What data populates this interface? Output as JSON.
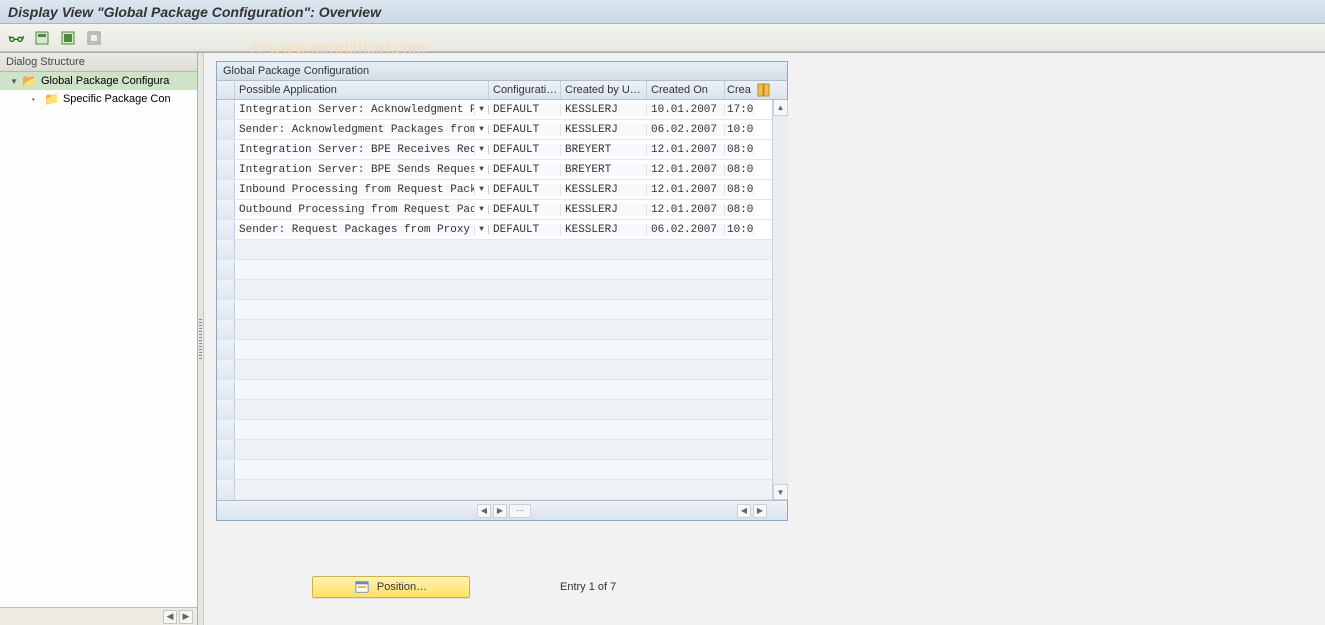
{
  "title": "Display View \"Global Package Configuration\": Overview",
  "watermark": "© www.tutorialkart.com",
  "toolbar": {
    "btn_glasses": "toggle-view",
    "btn_sel1": "select-block",
    "btn_sel2": "select-all",
    "btn_sel3": "deselect-all"
  },
  "sidebar": {
    "header": "Dialog Structure",
    "items": [
      {
        "label": "Global Package Configura",
        "selected": true,
        "expanded": true,
        "level": 0
      },
      {
        "label": "Specific Package Con",
        "selected": false,
        "expanded": false,
        "level": 1
      }
    ]
  },
  "grid": {
    "title": "Global Package Configuration",
    "columns": {
      "app": "Possible Application",
      "cfg": "Configurati…",
      "usr": "Created by U…",
      "dt": "Created On",
      "tm": "Crea"
    },
    "rows": [
      {
        "app": "Integration Server: Acknowledgment Pa…",
        "cfg": "DEFAULT",
        "usr": "KESSLERJ",
        "dt": "10.01.2007",
        "tm": "17:0"
      },
      {
        "app": "Sender: Acknowledgment Packages from …",
        "cfg": "DEFAULT",
        "usr": "KESSLERJ",
        "dt": "06.02.2007",
        "tm": "10:0"
      },
      {
        "app": "Integration Server: BPE Receives Requ…",
        "cfg": "DEFAULT",
        "usr": "BREYERT",
        "dt": "12.01.2007",
        "tm": "08:0"
      },
      {
        "app": "Integration Server: BPE Sends Request…",
        "cfg": "DEFAULT",
        "usr": "BREYERT",
        "dt": "12.01.2007",
        "tm": "08:0"
      },
      {
        "app": "Inbound Processing from Request Packa…",
        "cfg": "DEFAULT",
        "usr": "KESSLERJ",
        "dt": "12.01.2007",
        "tm": "08:0"
      },
      {
        "app": "Outbound Processing from Request Pack…",
        "cfg": "DEFAULT",
        "usr": "KESSLERJ",
        "dt": "12.01.2007",
        "tm": "08:0"
      },
      {
        "app": "Sender: Request Packages from Proxy t…",
        "cfg": "DEFAULT",
        "usr": "KESSLERJ",
        "dt": "06.02.2007",
        "tm": "10:0"
      }
    ],
    "empty_rows": 13
  },
  "footer": {
    "position_button": "Position…",
    "entry_text": "Entry 1 of 7"
  }
}
